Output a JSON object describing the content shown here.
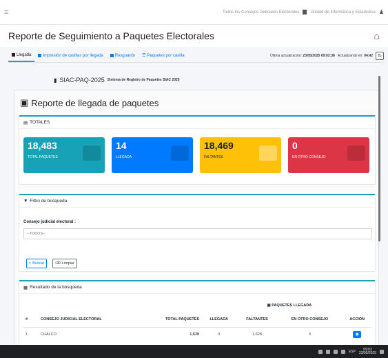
{
  "topbar": {
    "menu_icon": "hamburger-icon",
    "context": "Todos los Consejos Judiciales Electorales",
    "unit": "Unidad de Informática y Estadística",
    "user_icon": "user-icon"
  },
  "header": {
    "title": "Reporte de Seguimiento a Paquetes Electorales",
    "home_icon": "home-icon"
  },
  "tabs": [
    {
      "label": "Llegada",
      "icon": "box-icon",
      "active": true
    },
    {
      "label": "Impresión de casillas por llegada",
      "icon": "print-icon",
      "active": false
    },
    {
      "label": "Resguardo",
      "icon": "users-icon",
      "active": false
    },
    {
      "label": "Paquetes por casilla",
      "icon": "list-icon",
      "active": false
    }
  ],
  "status": {
    "last_update_label": "Última actualización:",
    "last_update_value": "23/05/2025 09:03:38",
    "updating_label": "Actualizando en:",
    "updating_value": "04:42"
  },
  "system": {
    "code": "SIAC-PAQ-2025",
    "description": "Sistema de Registro de Paquetes SIAC 2025"
  },
  "report": {
    "title": "Reporte de llegada de paquetes",
    "totales_label": "TOTALES",
    "stats": [
      {
        "value": "18,483",
        "label": "TOTAL PAQUETES",
        "color": "#17a2b8"
      },
      {
        "value": "14",
        "label": "LLEGADA",
        "color": "#007bff"
      },
      {
        "value": "18,469",
        "label": "FALTANTES",
        "color": "#ffc107"
      },
      {
        "value": "0",
        "label": "EN OTRO CONSEJO",
        "color": "#dc3545"
      }
    ]
  },
  "filter": {
    "title": "Filtro de búsqueda",
    "consejo_label": "Consejo judicial electoral :",
    "consejo_value": "--TODOS--",
    "buscar_label": "Buscar",
    "limpiar_label": "Limpiar"
  },
  "results": {
    "title": "Resultado de la búsqueda",
    "group_header": "PAQUETES LLEGADA",
    "columns": [
      "#",
      "CONSEJO JUDICIAL ELECTORAL",
      "TOTAL PAQUETES",
      "LLEGADA",
      "FALTANTES",
      "EN OTRO CONSEJO",
      "ACCIÓN"
    ],
    "rows": [
      {
        "n": "1",
        "consejo": "CHALCO",
        "total": "1,628",
        "llegada": "0",
        "faltantes": "1,628",
        "otro": "0"
      }
    ]
  },
  "taskbar": {
    "lang": "ESP",
    "time": "09:03",
    "date": "23/05/2025"
  },
  "colors": {
    "accent": "#17a2b8",
    "primary": "#007bff",
    "warning": "#ffc107",
    "danger": "#dc3545"
  }
}
